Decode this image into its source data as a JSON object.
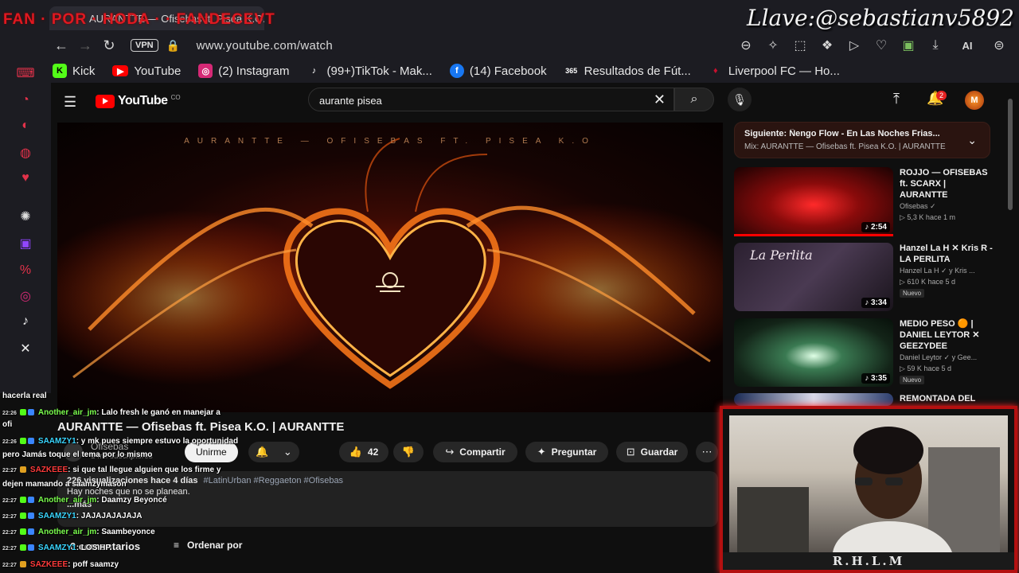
{
  "overlay": {
    "banner": "FAN · POR · HODA · · FANDECEVT",
    "handle": "Llave:@sebastianv5892",
    "cam_label": "R.H.L.M"
  },
  "browser": {
    "tab_title": "AURANTTE — Ofisebas ft. Pisea K.O.",
    "vpn": "VPN",
    "url": "www.youtube.com/watch",
    "ai_label": "AI",
    "bookmarks": [
      {
        "label": "Kick",
        "icon": "kick-icon",
        "color": "#53fc18"
      },
      {
        "label": "YouTube",
        "icon": "youtube-icon",
        "color": "#ff0000"
      },
      {
        "label": "(2) Instagram",
        "icon": "instagram-icon",
        "color": "#d62976"
      },
      {
        "label": "(99+)TikTok - Mak...",
        "icon": "tiktok-icon",
        "color": "#111111"
      },
      {
        "label": "(14) Facebook",
        "icon": "facebook-icon",
        "color": "#1877f2"
      },
      {
        "label": "Resultados de Fút...",
        "icon": "scores-icon",
        "color": "#333333"
      },
      {
        "label": "Liverpool FC — Ho...",
        "icon": "liverpool-icon",
        "color": "#c8102e"
      }
    ]
  },
  "youtube": {
    "logo_text": "YouTube",
    "logo_country": "CO",
    "search_query": "aurante pisea",
    "notification_count": "2",
    "player_title": "AURANTTE — OFISEBAS FT. PISEA K.O",
    "video_title": "AURANTTE — Ofisebas ft. Pisea K.O. | AURANTTE",
    "channel_name": "Ofisebas",
    "channel_subs": "1 mil suscriptores",
    "join_label": "Unirme",
    "likes": "42",
    "share_label": "Compartir",
    "ask_label": "Preguntar",
    "save_label": "Guardar",
    "views_date": "226 visualizaciones  hace 4 días",
    "hashtags": "#LatinUrban #Reggaeton #Ofisebas",
    "description": "Hay noches que no se planean.",
    "description_more": "...más",
    "comments_label": "0 comentarios",
    "sort_label": "Ordenar por",
    "up_next": {
      "line1": "Siguiente: Ñengo Flow - En Las Noches Frias...",
      "line2": "Mix: AURANTTE — Ofisebas ft. Pisea K.O. | AURANTTE"
    },
    "recommendations": [
      {
        "title": "ROJJO — OFISEBAS ft. SCARX | AURANTTE",
        "channel": "Ofisebas ✓",
        "views": "▷ 5,3 K  hace 1 m",
        "duration": "♪ 2:54",
        "badge": "",
        "thumb": "#8a0b0b"
      },
      {
        "title": "Hanzel La H ✕ Kris R - LA PERLITA",
        "channel": "Hanzel La H ✓ y Kris ...",
        "views": "▷ 610 K  hace 5 d",
        "duration": "♪ 3:34",
        "badge": "Nuevo",
        "thumb": "#3a2a3a"
      },
      {
        "title": "MEDIO PESO 🟠 | DANIEL LEYTOR ✕ GEEZYDEE",
        "channel": "Daniel Leytor ✓ y Gee...",
        "views": "▷ 59 K  hace 5 d",
        "duration": "♪ 3:35",
        "badge": "Nuevo",
        "thumb": "#1f3a2a"
      },
      {
        "title": "REMONTADA DEL",
        "channel": "",
        "views": "",
        "duration": "",
        "badge": "",
        "thumb": "#2d3f6e"
      }
    ]
  },
  "chat": [
    {
      "time": "",
      "user": "",
      "msg": "hacerla real",
      "color": "#ffffff"
    },
    {
      "time": "22:26",
      "user": "Another_air_jm",
      "msg": ": Lalo fresh le ganó en manejar a",
      "color": "#7cff4f"
    },
    {
      "time": "",
      "user": "",
      "msg": "ofi",
      "color": "#ffffff"
    },
    {
      "time": "22:26",
      "user": "SAAMZY1",
      "msg": ": y mk pues siempre estuvo la oportunidad",
      "color": "#3ad6ff"
    },
    {
      "time": "",
      "user": "",
      "msg": "pero Jamás toque el tema por lo mismo",
      "color": "#ffffff"
    },
    {
      "time": "22:27",
      "user": "SAZKEEE",
      "msg": ": si que tal llegue alguien que los firme y",
      "color": "#ff3b3b"
    },
    {
      "time": "",
      "user": "",
      "msg": "dejen mamando a saamzymason",
      "color": "#ffffff"
    },
    {
      "time": "22:27",
      "user": "Another_air_jm",
      "msg": ": Daamzy Beyoncé",
      "color": "#7cff4f"
    },
    {
      "time": "22:27",
      "user": "SAAMZY1",
      "msg": ": JAJAJAJAJAJA",
      "color": "#3ad6ff"
    },
    {
      "time": "22:27",
      "user": "Another_air_jm",
      "msg": ": Saambeyonce",
      "color": "#7cff4f"
    },
    {
      "time": "22:27",
      "user": "SAAMZY1",
      "msg": ": LOS HP",
      "color": "#3ad6ff"
    },
    {
      "time": "22:27",
      "user": "SAZKEEE",
      "msg": ": poff saamzy",
      "color": "#ff3b3b"
    }
  ],
  "colors": {
    "accent_red": "#ff0000",
    "sidebar_icon": "#e2324a",
    "bg": "#0f0f0f"
  }
}
